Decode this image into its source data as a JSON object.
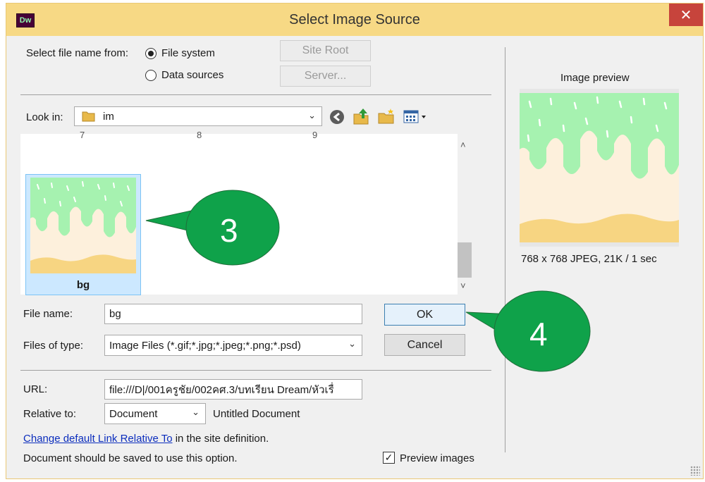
{
  "app": {
    "icon_text": "Dw",
    "title": "Select Image Source",
    "close_glyph": "✕"
  },
  "source": {
    "label": "Select file name from:",
    "options": [
      {
        "label": "File system",
        "checked": true
      },
      {
        "label": "Data sources",
        "checked": false
      }
    ],
    "site_root_label": "Site Root",
    "server_label": "Server..."
  },
  "look_in": {
    "label": "Look in:",
    "folder": "im"
  },
  "files": {
    "top_row_labels": [
      "7",
      "8",
      "9"
    ],
    "selected": {
      "name": "bg"
    }
  },
  "file_name": {
    "label": "File name:",
    "value": "bg"
  },
  "file_type": {
    "label": "Files of type:",
    "value": "Image Files (*.gif;*.jpg;*.jpeg;*.png;*.psd)"
  },
  "buttons": {
    "ok": "OK",
    "cancel": "Cancel"
  },
  "url": {
    "label": "URL:",
    "value": "file:///D|/001ครูชัย/002คศ.3/บทเรียน Dream/หัวเรื่"
  },
  "relative": {
    "label": "Relative to:",
    "value": "Document",
    "doc_name": "Untitled Document"
  },
  "link_line": {
    "link": "Change default Link Relative To",
    "rest": "in the site definition."
  },
  "note": "Document should be saved to use this option.",
  "preview": {
    "label": "Image preview",
    "info": "768 x 768 JPEG, 21K / 1 sec",
    "checkbox_label": "Preview images",
    "checked": true
  },
  "callouts": [
    "3",
    "4"
  ],
  "colors": {
    "title_bar": "#f7d985",
    "close_button": "#c7443c",
    "callout_green": "#0fa24a",
    "slime_green": "#a6f2b0",
    "cream": "#fdf0dc",
    "sand": "#f7d582"
  }
}
